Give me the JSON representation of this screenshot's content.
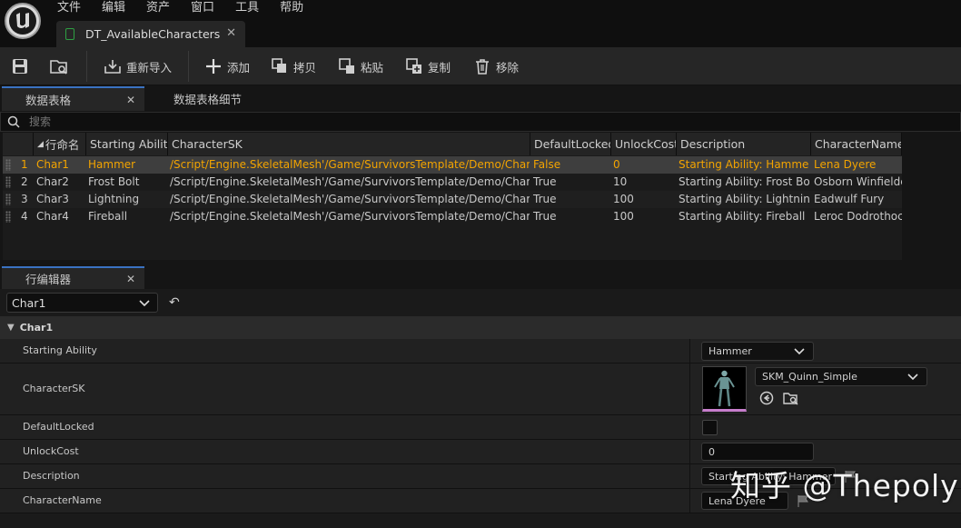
{
  "menu": [
    "文件",
    "编辑",
    "资产",
    "窗口",
    "工具",
    "帮助"
  ],
  "document_tab": {
    "title": "DT_AvailableCharacters"
  },
  "toolbar": {
    "reimport": "重新导入",
    "add": "添加",
    "copy": "拷贝",
    "paste": "粘贴",
    "duplicate": "复制",
    "remove": "移除"
  },
  "panel_tabs": {
    "data_table": "数据表格",
    "data_table_details": "数据表格细节"
  },
  "search": {
    "placeholder": "搜索"
  },
  "table": {
    "columns": [
      "行命名",
      "Starting Ability",
      "CharacterSK",
      "DefaultLocked",
      "UnlockCost",
      "Description",
      "CharacterName"
    ],
    "rows": [
      {
        "index": "1",
        "name": "Char1",
        "ability": "Hammer",
        "sk": "/Script/Engine.SkeletalMesh'/Game/SurvivorsTemplate/Demo/Characters",
        "locked": "False",
        "cost": "0",
        "desc": "Starting Ability: Hammer",
        "cname": "Lena Dyere"
      },
      {
        "index": "2",
        "name": "Char2",
        "ability": "Frost Bolt",
        "sk": "/Script/Engine.SkeletalMesh'/Game/SurvivorsTemplate/Demo/Characters",
        "locked": "True",
        "cost": "10",
        "desc": "Starting Ability: Frost Bolt",
        "cname": "Osborn Winfielde"
      },
      {
        "index": "3",
        "name": "Char3",
        "ability": "Lightning",
        "sk": "/Script/Engine.SkeletalMesh'/Game/SurvivorsTemplate/Demo/Characters",
        "locked": "True",
        "cost": "100",
        "desc": "Starting Ability: Lightning",
        "cname": "Eadwulf Fury"
      },
      {
        "index": "4",
        "name": "Char4",
        "ability": "Fireball",
        "sk": "/Script/Engine.SkeletalMesh'/Game/SurvivorsTemplate/Demo/Characters",
        "locked": "True",
        "cost": "100",
        "desc": "Starting Ability: Fireball",
        "cname": "Leroc Dodrothoc"
      }
    ]
  },
  "row_editor": {
    "tab_label": "行编辑器",
    "row_selector": "Char1",
    "category": "Char1",
    "properties": {
      "starting_ability": {
        "label": "Starting Ability",
        "value": "Hammer"
      },
      "character_sk": {
        "label": "CharacterSK",
        "value": "SKM_Quinn_Simple"
      },
      "default_locked": {
        "label": "DefaultLocked",
        "checked": false
      },
      "unlock_cost": {
        "label": "UnlockCost",
        "value": "0"
      },
      "description": {
        "label": "Description",
        "value": "Starting Ability: Hammer"
      },
      "character_name": {
        "label": "CharacterName",
        "value": "Lena Dyere"
      }
    }
  },
  "watermark": "知乎 @Thepoly",
  "colors": {
    "accent_selected_text": "#f3a400",
    "tab_highlight": "#3a72c2",
    "thumbnail_underline": "#c77dcc"
  }
}
